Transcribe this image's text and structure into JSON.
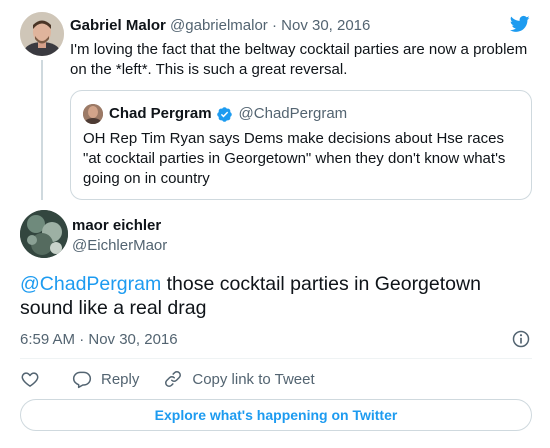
{
  "parent_tweet": {
    "name": "Gabriel Malor",
    "handle": "@gabrielmalor",
    "separator": "·",
    "date": "Nov 30, 2016",
    "text": "I'm loving the fact that the beltway cocktail parties are now a problem on the *left*. This is such a great reversal."
  },
  "quoted_tweet": {
    "name": "Chad Pergram",
    "handle": "@ChadPergram",
    "text": "OH Rep Tim Ryan says Dems make decisions about Hse races \"at cocktail parties in Georgetown\" when they don't know what's going on in country"
  },
  "main_tweet": {
    "name": "maor eichler",
    "handle": "@EichlerMaor",
    "mention": "@ChadPergram",
    "text": " those cocktail parties in Georgetown sound like a real drag",
    "timestamp": "6:59 AM · Nov 30, 2016"
  },
  "actions": {
    "reply_label": "Reply",
    "copy_link_label": "Copy link to Tweet"
  },
  "explore_label": "Explore what's happening on Twitter",
  "colors": {
    "accent": "#1d9bf0",
    "secondary_text": "#536471",
    "border": "#cfd9de"
  },
  "icons": [
    "twitter-bird-icon",
    "verified-badge-icon",
    "info-icon",
    "heart-icon",
    "reply-bubble-icon",
    "link-icon"
  ]
}
